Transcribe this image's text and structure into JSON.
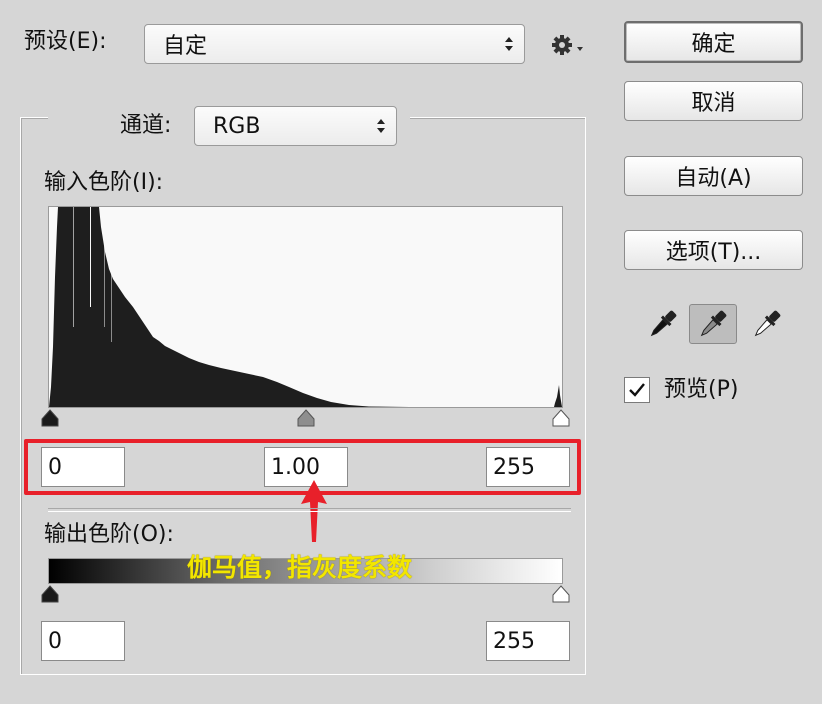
{
  "preset": {
    "label": "预设(E):",
    "value": "自定"
  },
  "channel": {
    "label": "通道:",
    "value": "RGB"
  },
  "input_levels": {
    "label": "输入色阶(I):",
    "black": "0",
    "gamma": "1.00",
    "white": "255"
  },
  "output_levels": {
    "label": "输出色阶(O):",
    "black": "0",
    "white": "255"
  },
  "buttons": {
    "ok": "确定",
    "cancel": "取消",
    "auto": "自动(A)",
    "options": "选项(T)..."
  },
  "preview": {
    "label": "预览(P)",
    "checked": true
  },
  "annotation": {
    "text": "伽马值，指灰度系数",
    "color": "#f2e600"
  },
  "colors": {
    "highlight": "#e8202a",
    "histogram": "#1e1e1e"
  }
}
